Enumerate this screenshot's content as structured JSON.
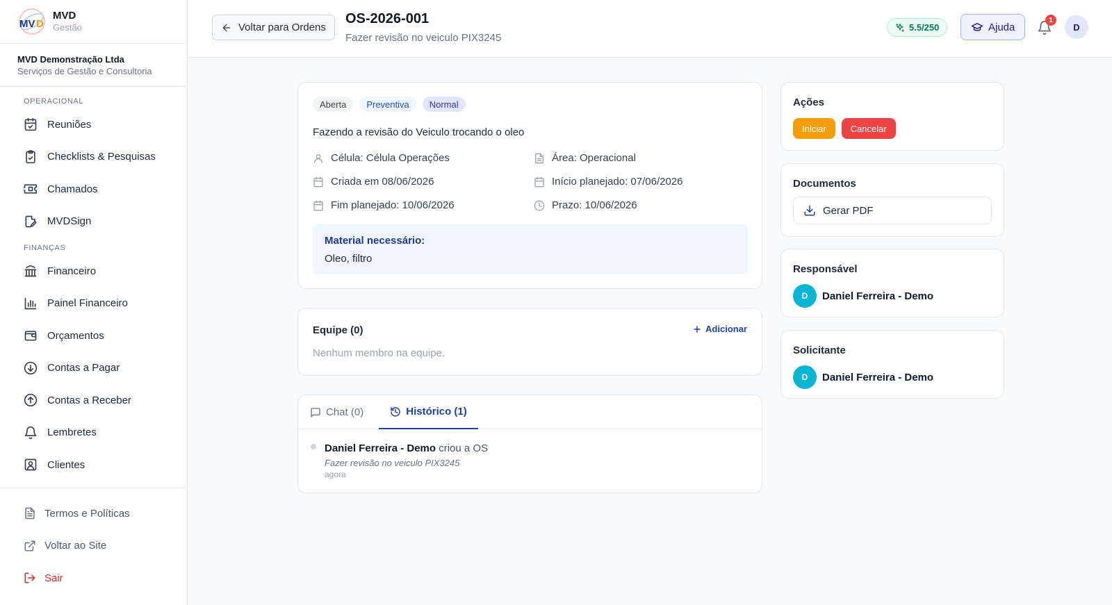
{
  "brand": {
    "name": "MVD",
    "sub": "Gestão"
  },
  "company": {
    "name": "MVD Demonstração Ltda",
    "sub": "Serviços de Gestão e Consultoria"
  },
  "sidebar": {
    "sections": [
      {
        "label": "OPERACIONAL",
        "items": [
          {
            "label": "Reuniões",
            "icon": "calendar-check-icon"
          },
          {
            "label": "Checklists & Pesquisas",
            "icon": "clipboard-check-icon"
          },
          {
            "label": "Chamados",
            "icon": "ticket-icon"
          },
          {
            "label": "MVDSign",
            "icon": "sign-document-icon"
          }
        ]
      },
      {
        "label": "FINANÇAS",
        "items": [
          {
            "label": "Financeiro",
            "icon": "bank-icon"
          },
          {
            "label": "Painel Financeiro",
            "icon": "bar-chart-icon"
          },
          {
            "label": "Orçamentos",
            "icon": "wallet-icon"
          },
          {
            "label": "Contas a Pagar",
            "icon": "arrow-down-circle-icon"
          },
          {
            "label": "Contas a Receber",
            "icon": "arrow-up-circle-icon"
          },
          {
            "label": "Lembretes",
            "icon": "bell-icon"
          },
          {
            "label": "Clientes",
            "icon": "user-square-icon"
          }
        ]
      }
    ],
    "footer": [
      {
        "label": "Termos e Políticas",
        "icon": "file-text-icon"
      },
      {
        "label": "Voltar ao Site",
        "icon": "external-link-icon"
      },
      {
        "label": "Sair",
        "icon": "logout-icon"
      }
    ]
  },
  "header": {
    "back_label": "Voltar para Ordens",
    "title": "OS-2026-001",
    "subtitle": "Fazer revisão no veiculo PIX3245",
    "credits": "5.5/250",
    "help_label": "Ajuda",
    "notif_count": "1",
    "avatar": "D"
  },
  "order": {
    "badges": [
      "Aberta",
      "Preventiva",
      "Normal"
    ],
    "description": "Fazendo a revisão do Veiculo trocando o oleo",
    "cell": "Célula: Célula Operações",
    "area": "Área: Operacional",
    "created": "Criada em 08/06/2026",
    "start_planned": "Início planejado: 07/06/2026",
    "end_planned": "Fim planejado: 10/06/2026",
    "deadline": "Prazo: 10/06/2026",
    "material_title": "Material necessário:",
    "material_text": "Oleo, filtro"
  },
  "team": {
    "title": "Equipe (0)",
    "add_label": "Adicionar",
    "empty": "Nenhum membro na equipe."
  },
  "tabs": {
    "chat_label": "Chat (0)",
    "history_label": "Histórico (1)",
    "history": [
      {
        "user": "Daniel Ferreira - Demo",
        "action": "criou a OS",
        "detail": "Fazer revisão no veiculo PIX3245",
        "time": "agora"
      }
    ]
  },
  "actions": {
    "title": "Ações",
    "start_label": "Iniciar",
    "cancel_label": "Cancelar"
  },
  "documents": {
    "title": "Documentos",
    "pdf_label": "Gerar PDF"
  },
  "responsible": {
    "title": "Responsável",
    "initial": "D",
    "name": "Daniel Ferreira - Demo"
  },
  "requester": {
    "title": "Solicitante",
    "initial": "D",
    "name": "Daniel Ferreira - Demo"
  },
  "colors": {
    "primary": "#1e40af",
    "orange": "#f59e0b",
    "danger": "#ef4444",
    "teal": "#06b6d4"
  }
}
